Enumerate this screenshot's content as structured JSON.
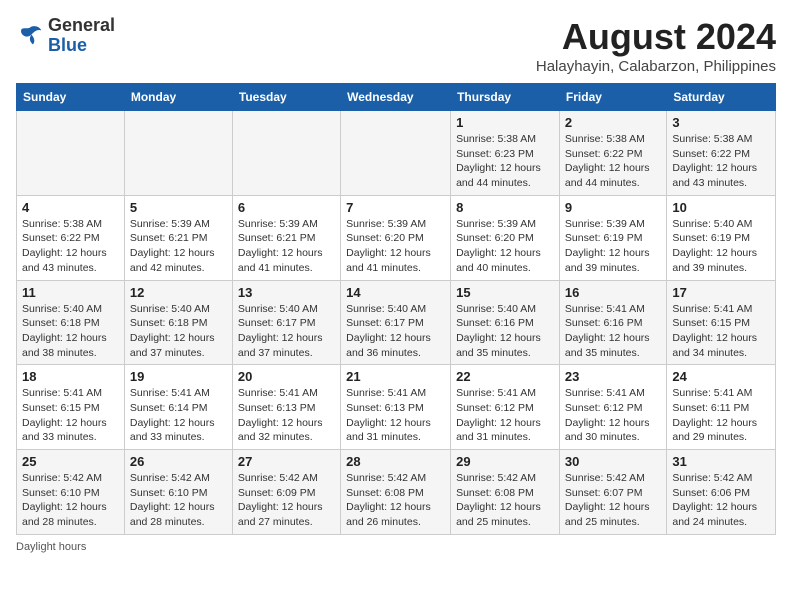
{
  "header": {
    "logo_general": "General",
    "logo_blue": "Blue",
    "month_title": "August 2024",
    "subtitle": "Halayhayin, Calabarzon, Philippines"
  },
  "days_of_week": [
    "Sunday",
    "Monday",
    "Tuesday",
    "Wednesday",
    "Thursday",
    "Friday",
    "Saturday"
  ],
  "weeks": [
    [
      {
        "day": "",
        "info": ""
      },
      {
        "day": "",
        "info": ""
      },
      {
        "day": "",
        "info": ""
      },
      {
        "day": "",
        "info": ""
      },
      {
        "day": "1",
        "info": "Sunrise: 5:38 AM\nSunset: 6:23 PM\nDaylight: 12 hours\nand 44 minutes."
      },
      {
        "day": "2",
        "info": "Sunrise: 5:38 AM\nSunset: 6:22 PM\nDaylight: 12 hours\nand 44 minutes."
      },
      {
        "day": "3",
        "info": "Sunrise: 5:38 AM\nSunset: 6:22 PM\nDaylight: 12 hours\nand 43 minutes."
      }
    ],
    [
      {
        "day": "4",
        "info": "Sunrise: 5:38 AM\nSunset: 6:22 PM\nDaylight: 12 hours\nand 43 minutes."
      },
      {
        "day": "5",
        "info": "Sunrise: 5:39 AM\nSunset: 6:21 PM\nDaylight: 12 hours\nand 42 minutes."
      },
      {
        "day": "6",
        "info": "Sunrise: 5:39 AM\nSunset: 6:21 PM\nDaylight: 12 hours\nand 41 minutes."
      },
      {
        "day": "7",
        "info": "Sunrise: 5:39 AM\nSunset: 6:20 PM\nDaylight: 12 hours\nand 41 minutes."
      },
      {
        "day": "8",
        "info": "Sunrise: 5:39 AM\nSunset: 6:20 PM\nDaylight: 12 hours\nand 40 minutes."
      },
      {
        "day": "9",
        "info": "Sunrise: 5:39 AM\nSunset: 6:19 PM\nDaylight: 12 hours\nand 39 minutes."
      },
      {
        "day": "10",
        "info": "Sunrise: 5:40 AM\nSunset: 6:19 PM\nDaylight: 12 hours\nand 39 minutes."
      }
    ],
    [
      {
        "day": "11",
        "info": "Sunrise: 5:40 AM\nSunset: 6:18 PM\nDaylight: 12 hours\nand 38 minutes."
      },
      {
        "day": "12",
        "info": "Sunrise: 5:40 AM\nSunset: 6:18 PM\nDaylight: 12 hours\nand 37 minutes."
      },
      {
        "day": "13",
        "info": "Sunrise: 5:40 AM\nSunset: 6:17 PM\nDaylight: 12 hours\nand 37 minutes."
      },
      {
        "day": "14",
        "info": "Sunrise: 5:40 AM\nSunset: 6:17 PM\nDaylight: 12 hours\nand 36 minutes."
      },
      {
        "day": "15",
        "info": "Sunrise: 5:40 AM\nSunset: 6:16 PM\nDaylight: 12 hours\nand 35 minutes."
      },
      {
        "day": "16",
        "info": "Sunrise: 5:41 AM\nSunset: 6:16 PM\nDaylight: 12 hours\nand 35 minutes."
      },
      {
        "day": "17",
        "info": "Sunrise: 5:41 AM\nSunset: 6:15 PM\nDaylight: 12 hours\nand 34 minutes."
      }
    ],
    [
      {
        "day": "18",
        "info": "Sunrise: 5:41 AM\nSunset: 6:15 PM\nDaylight: 12 hours\nand 33 minutes."
      },
      {
        "day": "19",
        "info": "Sunrise: 5:41 AM\nSunset: 6:14 PM\nDaylight: 12 hours\nand 33 minutes."
      },
      {
        "day": "20",
        "info": "Sunrise: 5:41 AM\nSunset: 6:13 PM\nDaylight: 12 hours\nand 32 minutes."
      },
      {
        "day": "21",
        "info": "Sunrise: 5:41 AM\nSunset: 6:13 PM\nDaylight: 12 hours\nand 31 minutes."
      },
      {
        "day": "22",
        "info": "Sunrise: 5:41 AM\nSunset: 6:12 PM\nDaylight: 12 hours\nand 31 minutes."
      },
      {
        "day": "23",
        "info": "Sunrise: 5:41 AM\nSunset: 6:12 PM\nDaylight: 12 hours\nand 30 minutes."
      },
      {
        "day": "24",
        "info": "Sunrise: 5:41 AM\nSunset: 6:11 PM\nDaylight: 12 hours\nand 29 minutes."
      }
    ],
    [
      {
        "day": "25",
        "info": "Sunrise: 5:42 AM\nSunset: 6:10 PM\nDaylight: 12 hours\nand 28 minutes."
      },
      {
        "day": "26",
        "info": "Sunrise: 5:42 AM\nSunset: 6:10 PM\nDaylight: 12 hours\nand 28 minutes."
      },
      {
        "day": "27",
        "info": "Sunrise: 5:42 AM\nSunset: 6:09 PM\nDaylight: 12 hours\nand 27 minutes."
      },
      {
        "day": "28",
        "info": "Sunrise: 5:42 AM\nSunset: 6:08 PM\nDaylight: 12 hours\nand 26 minutes."
      },
      {
        "day": "29",
        "info": "Sunrise: 5:42 AM\nSunset: 6:08 PM\nDaylight: 12 hours\nand 25 minutes."
      },
      {
        "day": "30",
        "info": "Sunrise: 5:42 AM\nSunset: 6:07 PM\nDaylight: 12 hours\nand 25 minutes."
      },
      {
        "day": "31",
        "info": "Sunrise: 5:42 AM\nSunset: 6:06 PM\nDaylight: 12 hours\nand 24 minutes."
      }
    ]
  ],
  "footer": {
    "note": "Daylight hours"
  }
}
